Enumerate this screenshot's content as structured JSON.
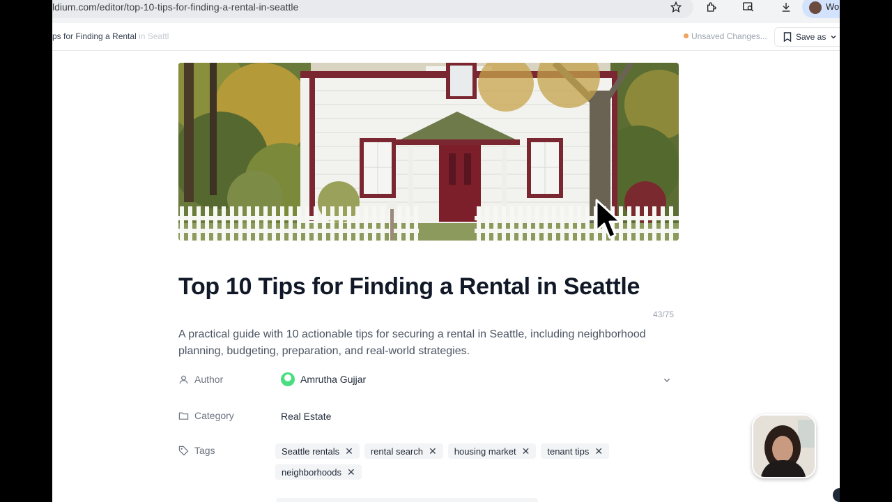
{
  "browser": {
    "url": "ldium.com/editor/top-10-tips-for-finding-a-rental-in-seattle",
    "profile_label": "Wo"
  },
  "editor": {
    "breadcrumb_visible": "ps for Finding a Rental",
    "breadcrumb_faded": "in Seattl",
    "unsaved_label": "Unsaved Changes...",
    "save_label": "Save as"
  },
  "article": {
    "title": "Top 10 Tips for Finding a Rental in Seattle",
    "title_counter": "43/75",
    "description": "A practical guide with 10 actionable tips for securing a rental in Seattle, including neighborhood planning, budgeting, preparation, and real-world strategies.",
    "author_label": "Author",
    "author_name": "Amrutha Gujjar",
    "category_label": "Category",
    "category_value": "Real Estate",
    "tags_label": "Tags",
    "tags": [
      "Seattle rentals",
      "rental search",
      "housing market",
      "tenant tips",
      "neighborhoods"
    ]
  },
  "colors": {
    "accent_unsaved": "#f0a35e",
    "author_avatar": "#4ade80"
  }
}
